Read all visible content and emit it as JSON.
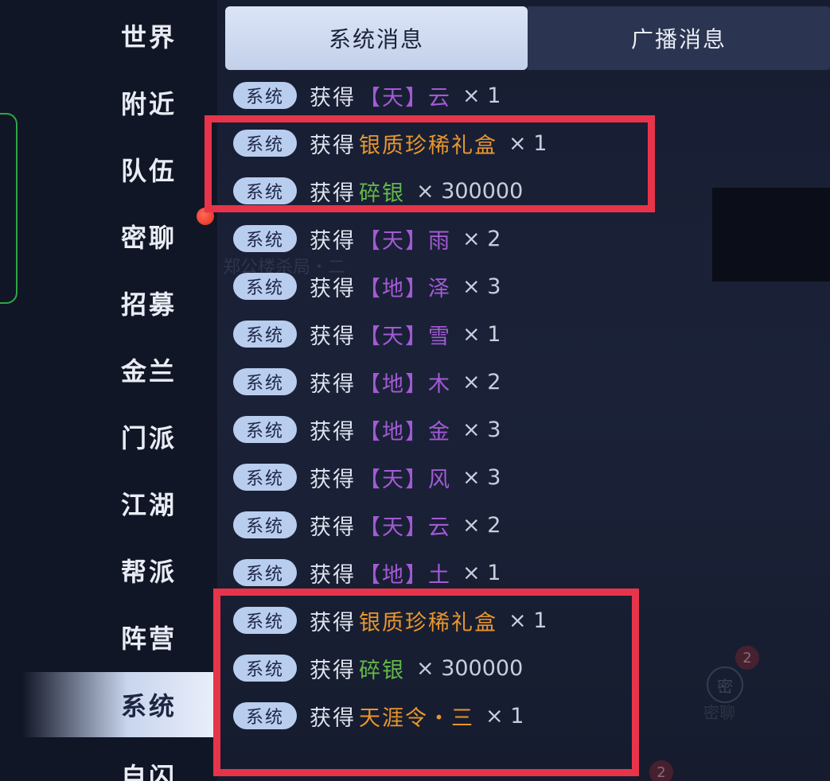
{
  "sidebar": {
    "items": [
      {
        "label": "世界"
      },
      {
        "label": "附近"
      },
      {
        "label": "队伍"
      },
      {
        "label": "密聊"
      },
      {
        "label": "招募"
      },
      {
        "label": "金兰"
      },
      {
        "label": "门派"
      },
      {
        "label": "江湖"
      },
      {
        "label": "帮派"
      },
      {
        "label": "阵营"
      },
      {
        "label": "系统"
      },
      {
        "label": "自闪"
      }
    ],
    "active_label": "系统"
  },
  "tabs": {
    "system": "系统消息",
    "broadcast": "广播消息"
  },
  "background": {
    "side_text_1": "郑公楼杀局・二",
    "side_text_2": "密聊",
    "side_icon": "密",
    "badge_count_1": "2",
    "badge_count_2": "2"
  },
  "messages": [
    {
      "tag": "系统",
      "verb": "获得",
      "item": "【天】云",
      "color": "purple",
      "qty": "× 1"
    },
    {
      "tag": "系统",
      "verb": "获得",
      "item": "银质珍稀礼盒",
      "color": "orange",
      "qty": "× 1"
    },
    {
      "tag": "系统",
      "verb": "获得",
      "item": "碎银",
      "color": "green",
      "qty": "× 300000"
    },
    {
      "tag": "系统",
      "verb": "获得",
      "item": "【天】雨",
      "color": "purple",
      "qty": "× 2"
    },
    {
      "tag": "系统",
      "verb": "获得",
      "item": "【地】泽",
      "color": "purple",
      "qty": "× 3"
    },
    {
      "tag": "系统",
      "verb": "获得",
      "item": "【天】雪",
      "color": "purple",
      "qty": "× 1"
    },
    {
      "tag": "系统",
      "verb": "获得",
      "item": "【地】木",
      "color": "purple",
      "qty": "× 2"
    },
    {
      "tag": "系统",
      "verb": "获得",
      "item": "【地】金",
      "color": "purple",
      "qty": "× 3"
    },
    {
      "tag": "系统",
      "verb": "获得",
      "item": "【天】风",
      "color": "purple",
      "qty": "× 3"
    },
    {
      "tag": "系统",
      "verb": "获得",
      "item": "【天】云",
      "color": "purple",
      "qty": "× 2"
    },
    {
      "tag": "系统",
      "verb": "获得",
      "item": "【地】土",
      "color": "purple",
      "qty": "× 1"
    },
    {
      "tag": "系统",
      "verb": "获得",
      "item": "银质珍稀礼盒",
      "color": "orange",
      "qty": "× 1"
    },
    {
      "tag": "系统",
      "verb": "获得",
      "item": "碎银",
      "color": "green",
      "qty": "× 300000"
    },
    {
      "tag": "系统",
      "verb": "获得",
      "item": "天涯令・三",
      "color": "orange",
      "qty": "× 1"
    }
  ],
  "colors": {
    "purple": "#a35ad6",
    "orange": "#e8962d",
    "green": "#63b84a",
    "highlight_frame": "#e8344a"
  }
}
